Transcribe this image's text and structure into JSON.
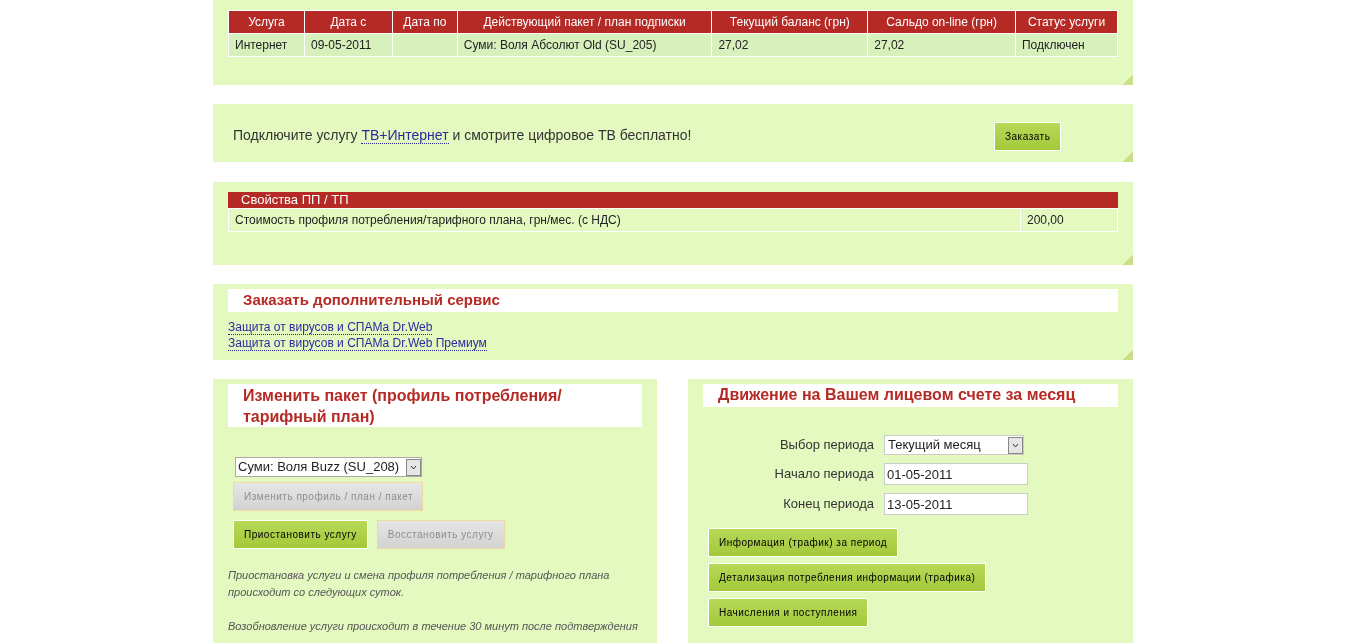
{
  "services_table": {
    "columns": [
      "Услуга",
      "Дата с",
      "Дата по",
      "Действующий пакет / план подписки",
      "Текущий баланс (грн)",
      "Сальдо on-line (грн)",
      "Статус услуги"
    ],
    "rows": [
      [
        "Интернет",
        "09-05-2011",
        "",
        "Суми: Воля Абсолют Old (SU_205)",
        "27,02",
        "27,02",
        "Подключен"
      ]
    ]
  },
  "promo": {
    "text_before": "Подключите услугу ",
    "link": "ТВ+Интернет",
    "text_after": " и смотрите цифровое ТВ бесплатно!",
    "button": "Заказать"
  },
  "properties": {
    "title": "Свойства ПП / ТП",
    "rows": [
      [
        "Стоимость профиля потребления/тарифного плана, грн/мес. (с НДС)",
        "200,00"
      ]
    ]
  },
  "extra_services": {
    "title": "Заказать дополнительный сервис",
    "links": [
      "Защита от вирусов и СПАМа Dr.Web",
      "Защита от вирусов и СПАМа Dr.Web Премиум"
    ]
  },
  "change_plan": {
    "title": "Изменить пакет (профиль потребления/ тарифный план)",
    "select": "Суми: Воля Buzz (SU_208)",
    "buttons": [
      {
        "label": "Изменить  профиль / план / пакет",
        "disabled": true
      },
      {
        "label": "Приостановить услугу",
        "disabled": false
      },
      {
        "label": "Восстановить услугу",
        "disabled": true
      }
    ],
    "notes": [
      "Приостановка услуги и смена профиля потребления / тарифного плана происходит со следующих суток.",
      "Возобновление услуги происходит в течение 30 минут после подтверждения"
    ]
  },
  "account_movement": {
    "title": "Движение на Вашем лицевом счете за месяц",
    "fields": [
      {
        "kind": "select",
        "label": "Выбор периода",
        "value": "Текущий месяц"
      },
      {
        "kind": "input",
        "label": "Начало периода",
        "value": "01-05-2011"
      },
      {
        "kind": "input",
        "label": "Конец периода",
        "value": "13-05-2011"
      }
    ],
    "buttons": [
      "Информация (трафик) за период",
      "Детализация потребления информации (трафика)",
      "Начисления и поступления"
    ]
  }
}
